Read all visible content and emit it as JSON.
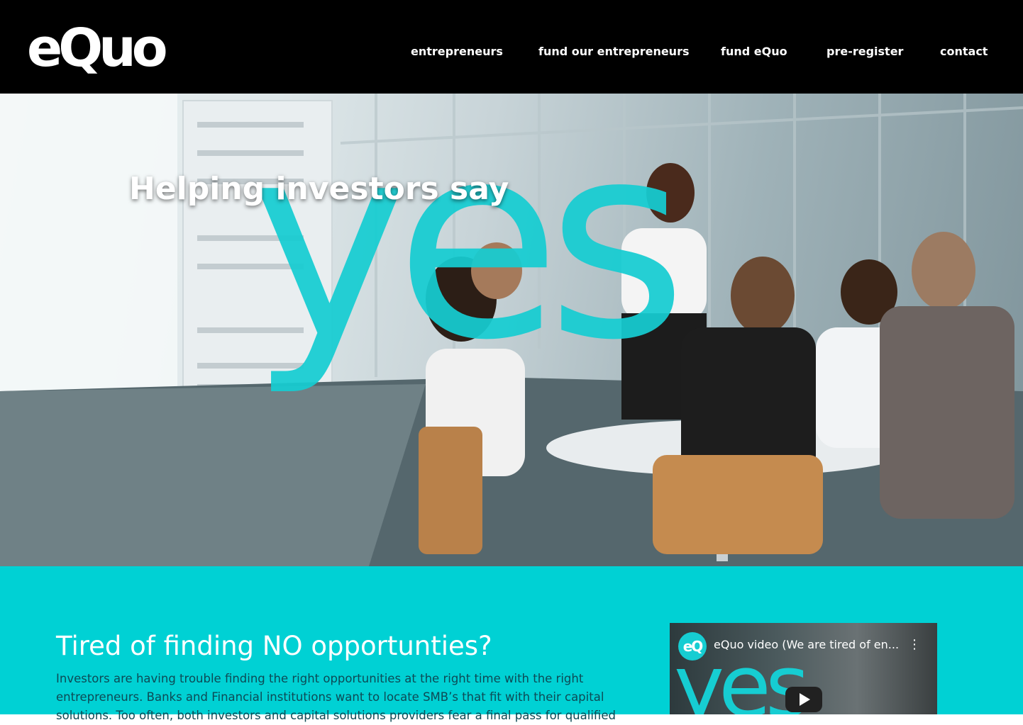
{
  "brand": {
    "logo_text": "eQuo"
  },
  "nav": {
    "items": [
      {
        "label": "entrepreneurs"
      },
      {
        "label": "fund our entrepreneurs"
      },
      {
        "label": "fund eQuo"
      },
      {
        "label": "pre-register"
      },
      {
        "label": "contact"
      }
    ]
  },
  "hero": {
    "tagline": "Helping investors say",
    "big_word": "yes"
  },
  "section": {
    "heading": "Tired of finding NO opportunties?",
    "body": "Investors are having trouble finding the right opportunities at the right time with the right entrepreneurs. Banks and Financial institutions want to locate SMB’s that fit with their capital solutions. Too often, both investors and capital solutions providers fear a final pass for qualified"
  },
  "video": {
    "channel_initials": "eQ",
    "title": "eQuo video (We are tired of en...",
    "menu_icon": "vertical-dots-icon",
    "play_icon": "play-icon",
    "overlay_word": "yes"
  },
  "colors": {
    "header_bg": "#000000",
    "accent": "#00d1d4",
    "yes_overlay": "#16cdd2",
    "body_text": "#0d4a55"
  }
}
